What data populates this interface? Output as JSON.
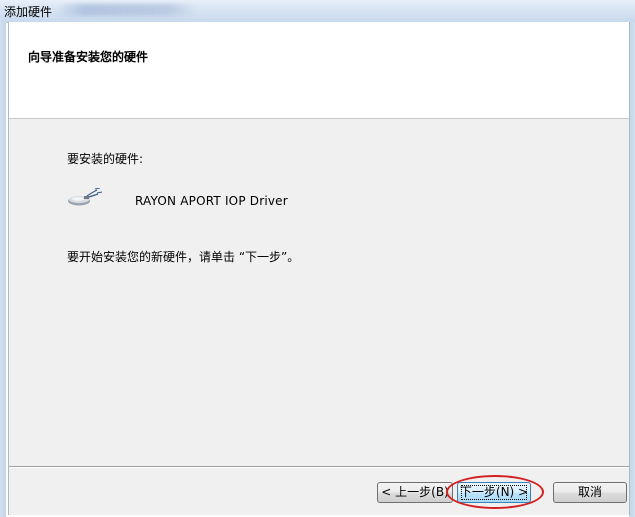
{
  "window": {
    "title": "添加硬件"
  },
  "header": {
    "title": "向导准备安装您的硬件"
  },
  "main": {
    "hardware_label": "要安装的硬件:",
    "device_name": "RAYON APORT IOP Driver",
    "device_icon": "hardware-device-icon",
    "instruction": "要开始安装您的新硬件，请单击 “下一步”。"
  },
  "buttons": {
    "back": "< 上一步(B)",
    "next": "下一步(N) >",
    "cancel": "取消"
  },
  "colors": {
    "highlight": "#d42020",
    "default_button_border": "#3c7fb1"
  }
}
